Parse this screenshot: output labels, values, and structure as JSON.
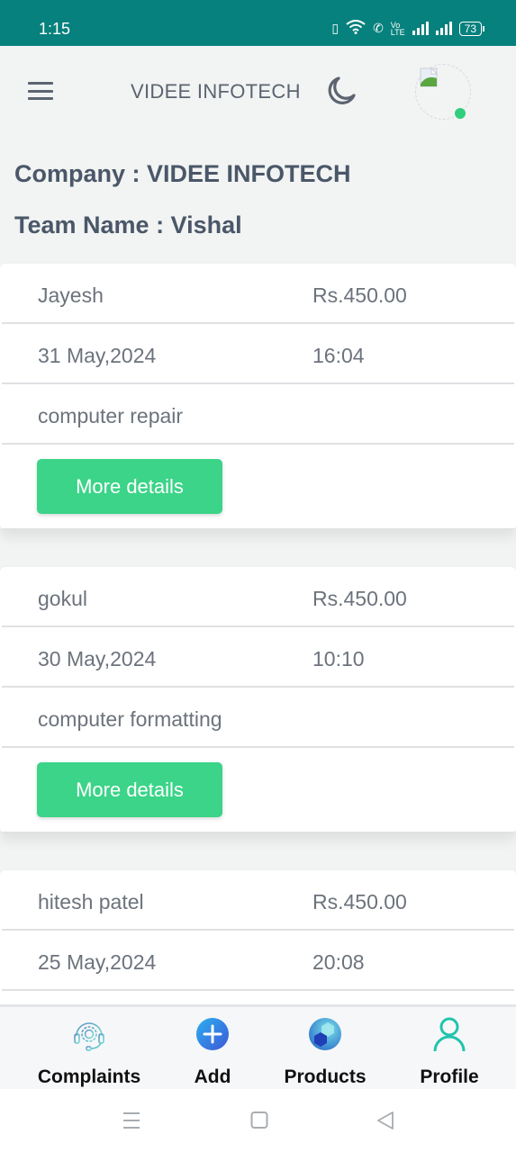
{
  "status_bar": {
    "time": "1:15",
    "battery": "73",
    "icons": [
      "vibrate-icon",
      "wifi-icon",
      "wifi-calling-icon",
      "volte-icon",
      "signal-icon",
      "signal-icon",
      "battery-icon"
    ]
  },
  "app_bar": {
    "menu_icon": "hamburger-menu-icon",
    "title": "VIDEE INFOTECH",
    "theme_icon": "moon-icon",
    "avatar_icon": "broken-image-avatar",
    "online_color": "#2fcf7d"
  },
  "info": {
    "company": "Company : VIDEE INFOTECH",
    "team": "Team Name : Vishal"
  },
  "complaints": [
    {
      "name": "Jayesh",
      "amount": "Rs.450.00",
      "date": "31 May,2024",
      "time": "16:04",
      "description": "computer repair",
      "button": "More details"
    },
    {
      "name": "gokul",
      "amount": "Rs.450.00",
      "date": "30 May,2024",
      "time": "10:10",
      "description": "computer formatting",
      "button": "More details"
    },
    {
      "name": "hitesh patel",
      "amount": "Rs.450.00",
      "date": "25 May,2024",
      "time": "20:08"
    }
  ],
  "bottom_nav": [
    {
      "label": "Complaints",
      "icon": "headset-support-icon"
    },
    {
      "label": "Add",
      "icon": "plus-circle-icon"
    },
    {
      "label": "Products",
      "icon": "cubes-icon"
    },
    {
      "label": "Profile",
      "icon": "user-icon"
    }
  ],
  "colors": {
    "status_bar": "#06817d",
    "accent_button": "#3bd488",
    "text_muted": "#6c737c",
    "heading": "#4a5768"
  }
}
